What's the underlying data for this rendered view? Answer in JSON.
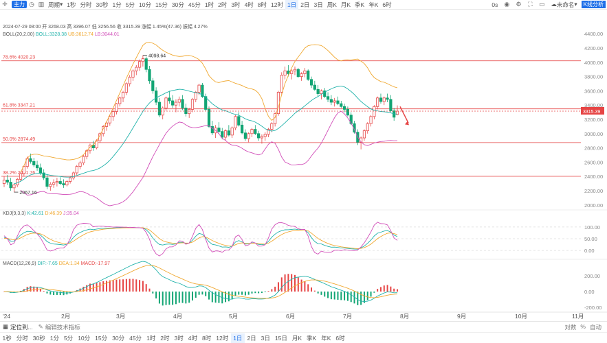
{
  "topbar": {
    "badge": "主力",
    "period_label": "周期",
    "periods": [
      "1秒",
      "分时",
      "30秒",
      "1分",
      "5分",
      "10分",
      "15分",
      "30分",
      "45分",
      "1时",
      "2时",
      "3时",
      "4时",
      "8时",
      "12时",
      "1日",
      "2日",
      "3日",
      "周K",
      "月K",
      "季K",
      "年K",
      "6时"
    ],
    "active_period": "1日",
    "timer": "0s",
    "draft": "未命名",
    "kline_analysis": "K线分析"
  },
  "main_info": {
    "date": "2024-07-29 08:00",
    "open_label": "开",
    "open": "3268.03",
    "high_label": "高",
    "high": "3396.07",
    "low_label": "低",
    "low": "3256.56",
    "close_label": "收",
    "close": "3315.39",
    "change_label": "涨幅",
    "change": "1.45%(47.36)",
    "amp_label": "振幅",
    "amp": "4.27%",
    "boll_name": "BOLL(20,2.00)",
    "boll_mid": "BOLL:3328.38",
    "boll_ub": "UB:3612.74",
    "boll_lb": "LB:3044.01"
  },
  "kdj_info": {
    "name": "KDJ(9,3,3)",
    "k": "K:42.61",
    "d": "D:46.39",
    "j": "J:35.04"
  },
  "macd_info": {
    "name": "MACD(12,26,9)",
    "dif": "DIF:-7.65",
    "dea": "DEA:1.34",
    "macd": "MACD:-17.97"
  },
  "fib": [
    {
      "label": "78.6% 4020.23",
      "price": 4020.23,
      "color": "#e64545"
    },
    {
      "label": "61.8% 3347.21",
      "price": 3347.21,
      "color": "#e64545"
    },
    {
      "label": "50.0% 2874.49",
      "price": 2874.49,
      "color": "#e64545"
    },
    {
      "label": "38.2% 2401.76",
      "price": 2401.76,
      "color": "#e64545"
    }
  ],
  "annotations": {
    "high": "4098.64",
    "low": "2067.16",
    "current_price": "3315.39"
  },
  "y_ticks": [
    "4400.00",
    "4200.00",
    "4000.00",
    "3800.00",
    "3600.00",
    "3400.00",
    "3200.00",
    "3000.00",
    "2800.00",
    "2600.00",
    "2400.00",
    "2200.00",
    "2000.00"
  ],
  "kdj_ticks": [
    "100.00",
    "50.00",
    "0.00"
  ],
  "macd_ticks": [
    "200.00",
    "0.00",
    "-200.00"
  ],
  "x_labels": [
    "'24",
    "2月",
    "3月",
    "4月",
    "5月",
    "6月",
    "7月",
    "8月",
    "9月",
    "10月",
    "11月"
  ],
  "bottom_tabs": {
    "tab1": "定位到...",
    "tab2": "编辑技术指标"
  },
  "bottom_periods": [
    "1秒",
    "分时",
    "30秒",
    "1分",
    "5分",
    "10分",
    "15分",
    "30分",
    "45分",
    "1时",
    "2时",
    "3时",
    "4时",
    "8时",
    "12时",
    "1日",
    "2日",
    "3日",
    "15日",
    "月K",
    "季K",
    "年K",
    "6时"
  ],
  "bottom_active": "1日",
  "bottom_right": {
    "log": "对数",
    "pct": "%",
    "auto": "自动"
  },
  "colors": {
    "up": "#e64545",
    "down": "#12a574",
    "mid": "#20b2aa",
    "band": "#f0a830",
    "lower": "#d14db8",
    "accent": "#1e6fe8"
  },
  "chart_data": {
    "type": "candlestick",
    "ylim": [
      1950,
      4450
    ],
    "candles": [
      [
        2300,
        2400,
        2250,
        2350
      ],
      [
        2350,
        2420,
        2280,
        2320
      ],
      [
        2320,
        2380,
        2200,
        2240
      ],
      [
        2240,
        2300,
        2180,
        2280
      ],
      [
        2280,
        2380,
        2250,
        2360
      ],
      [
        2360,
        2460,
        2330,
        2440
      ],
      [
        2440,
        2560,
        2400,
        2540
      ],
      [
        2540,
        2680,
        2510,
        2650
      ],
      [
        2650,
        2720,
        2580,
        2610
      ],
      [
        2610,
        2660,
        2530,
        2560
      ],
      [
        2560,
        2620,
        2480,
        2520
      ],
      [
        2520,
        2580,
        2420,
        2450
      ],
      [
        2450,
        2500,
        2350,
        2380
      ],
      [
        2380,
        2420,
        2220,
        2260
      ],
      [
        2260,
        2320,
        2200,
        2290
      ],
      [
        2290,
        2360,
        2240,
        2310
      ],
      [
        2310,
        2380,
        2260,
        2330
      ],
      [
        2330,
        2390,
        2280,
        2300
      ],
      [
        2300,
        2360,
        2240,
        2280
      ],
      [
        2280,
        2350,
        2260,
        2330
      ],
      [
        2330,
        2400,
        2300,
        2380
      ],
      [
        2380,
        2470,
        2350,
        2450
      ],
      [
        2450,
        2560,
        2420,
        2540
      ],
      [
        2540,
        2620,
        2500,
        2590
      ],
      [
        2590,
        2700,
        2560,
        2680
      ],
      [
        2680,
        2780,
        2640,
        2760
      ],
      [
        2760,
        2860,
        2720,
        2840
      ],
      [
        2840,
        2900,
        2760,
        2800
      ],
      [
        2800,
        2920,
        2780,
        2900
      ],
      [
        2900,
        3020,
        2870,
        3000
      ],
      [
        3000,
        3120,
        2960,
        3100
      ],
      [
        3100,
        3180,
        3040,
        3150
      ],
      [
        3150,
        3260,
        3110,
        3240
      ],
      [
        3240,
        3340,
        3180,
        3310
      ],
      [
        3310,
        3430,
        3270,
        3420
      ],
      [
        3420,
        3520,
        3380,
        3500
      ],
      [
        3500,
        3600,
        3440,
        3580
      ],
      [
        3580,
        3720,
        3540,
        3700
      ],
      [
        3700,
        3820,
        3660,
        3790
      ],
      [
        3790,
        3900,
        3740,
        3880
      ],
      [
        3880,
        3960,
        3820,
        3930
      ],
      [
        3930,
        4040,
        3880,
        4010
      ],
      [
        4010,
        4098,
        3940,
        4050
      ],
      [
        4050,
        4080,
        3860,
        3900
      ],
      [
        3900,
        3950,
        3700,
        3740
      ],
      [
        3740,
        3780,
        3560,
        3600
      ],
      [
        3600,
        3650,
        3400,
        3440
      ],
      [
        3440,
        3500,
        3230,
        3260
      ],
      [
        3260,
        3380,
        3200,
        3360
      ],
      [
        3360,
        3520,
        3320,
        3500
      ],
      [
        3500,
        3600,
        3420,
        3460
      ],
      [
        3460,
        3540,
        3360,
        3400
      ],
      [
        3400,
        3480,
        3300,
        3440
      ],
      [
        3440,
        3520,
        3380,
        3480
      ],
      [
        3480,
        3540,
        3330,
        3360
      ],
      [
        3360,
        3420,
        3240,
        3280
      ],
      [
        3280,
        3360,
        3220,
        3340
      ],
      [
        3340,
        3500,
        3300,
        3480
      ],
      [
        3480,
        3600,
        3440,
        3580
      ],
      [
        3580,
        3700,
        3540,
        3680
      ],
      [
        3680,
        3710,
        3500,
        3520
      ],
      [
        3520,
        3560,
        3320,
        3340
      ],
      [
        3340,
        3380,
        3080,
        3100
      ],
      [
        3100,
        3180,
        2980,
        3010
      ],
      [
        3010,
        3120,
        2940,
        3080
      ],
      [
        3080,
        3160,
        3000,
        3030
      ],
      [
        3030,
        3080,
        2920,
        2950
      ],
      [
        2950,
        3060,
        2900,
        3040
      ],
      [
        3040,
        3120,
        2960,
        2980
      ],
      [
        2980,
        3100,
        2940,
        3080
      ],
      [
        3080,
        3260,
        3050,
        3240
      ],
      [
        3240,
        3300,
        3100,
        3120
      ],
      [
        3120,
        3180,
        2990,
        3010
      ],
      [
        3010,
        3060,
        2900,
        2930
      ],
      [
        2930,
        3020,
        2880,
        3000
      ],
      [
        3000,
        3080,
        2950,
        3060
      ],
      [
        3060,
        3120,
        2980,
        3000
      ],
      [
        3000,
        3040,
        2900,
        2940
      ],
      [
        2940,
        2990,
        2860,
        2960
      ],
      [
        2960,
        3020,
        2900,
        2990
      ],
      [
        2990,
        3080,
        2950,
        3060
      ],
      [
        3060,
        3160,
        3020,
        3140
      ],
      [
        3140,
        3300,
        3100,
        3280
      ],
      [
        3280,
        3600,
        3250,
        3580
      ],
      [
        3580,
        3860,
        3540,
        3820
      ],
      [
        3820,
        3940,
        3760,
        3880
      ],
      [
        3880,
        3960,
        3800,
        3840
      ],
      [
        3840,
        3900,
        3760,
        3880
      ],
      [
        3880,
        3940,
        3820,
        3900
      ],
      [
        3900,
        3920,
        3780,
        3800
      ],
      [
        3800,
        3860,
        3740,
        3840
      ],
      [
        3840,
        3920,
        3790,
        3880
      ],
      [
        3880,
        3900,
        3740,
        3760
      ],
      [
        3760,
        3800,
        3640,
        3680
      ],
      [
        3680,
        3740,
        3600,
        3620
      ],
      [
        3620,
        3680,
        3520,
        3560
      ],
      [
        3560,
        3620,
        3480,
        3600
      ],
      [
        3600,
        3640,
        3500,
        3520
      ],
      [
        3520,
        3580,
        3440,
        3480
      ],
      [
        3480,
        3540,
        3400,
        3440
      ],
      [
        3440,
        3500,
        3380,
        3460
      ],
      [
        3460,
        3520,
        3400,
        3420
      ],
      [
        3420,
        3460,
        3360,
        3380
      ],
      [
        3380,
        3420,
        3300,
        3340
      ],
      [
        3340,
        3380,
        3240,
        3260
      ],
      [
        3260,
        3300,
        3120,
        3140
      ],
      [
        3140,
        3180,
        3000,
        3020
      ],
      [
        3020,
        3060,
        2840,
        2880
      ],
      [
        2880,
        2960,
        2780,
        2940
      ],
      [
        2940,
        3060,
        2900,
        3040
      ],
      [
        3040,
        3160,
        3000,
        3140
      ],
      [
        3140,
        3260,
        3100,
        3240
      ],
      [
        3240,
        3400,
        3200,
        3380
      ],
      [
        3380,
        3520,
        3340,
        3500
      ],
      [
        3500,
        3560,
        3420,
        3450
      ],
      [
        3450,
        3520,
        3400,
        3500
      ],
      [
        3500,
        3560,
        3440,
        3480
      ],
      [
        3480,
        3540,
        3300,
        3320
      ],
      [
        3320,
        3360,
        3180,
        3230
      ],
      [
        3268,
        3396,
        3256,
        3315
      ]
    ]
  }
}
